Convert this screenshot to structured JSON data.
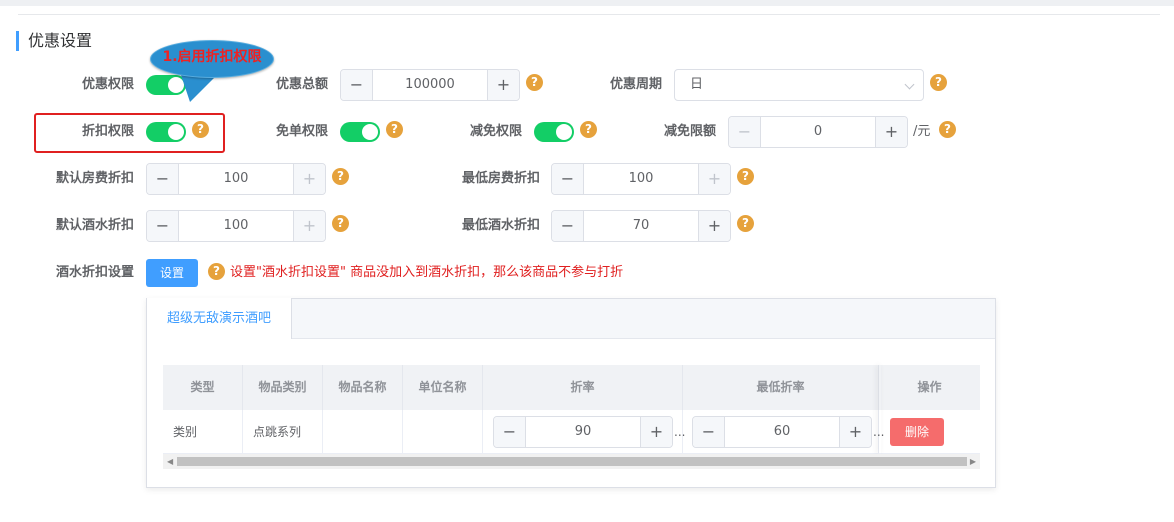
{
  "section": {
    "title": "优惠设置"
  },
  "callout": {
    "text": "1.启用折扣权限"
  },
  "form": {
    "row1": {
      "discount_auth_label": "优惠权限",
      "discount_total_label": "优惠总额",
      "discount_total_value": "100000",
      "discount_period_label": "优惠周期",
      "discount_period_value": "日"
    },
    "row2": {
      "rebate_auth_label": "折扣权限",
      "free_order_auth_label": "免单权限",
      "reduction_auth_label": "减免权限",
      "reduction_limit_label": "减免限额",
      "reduction_limit_value": "0",
      "reduction_limit_unit": "/元"
    },
    "row3": {
      "default_room_discount_label": "默认房费折扣",
      "default_room_discount_value": "100",
      "min_room_discount_label": "最低房费折扣",
      "min_room_discount_value": "100"
    },
    "row4": {
      "default_drink_discount_label": "默认酒水折扣",
      "default_drink_discount_value": "100",
      "min_drink_discount_label": "最低酒水折扣",
      "min_drink_discount_value": "70"
    },
    "row5": {
      "drink_discount_setting_label": "酒水折扣设置",
      "setting_button": "设置",
      "note": "设置\"酒水折扣设置\" 商品没加入到酒水折扣，那么该商品不参与打折"
    },
    "toggles": {
      "discount_auth": true,
      "rebate_auth": true,
      "free_order_auth": true,
      "reduction_auth": true
    }
  },
  "icons": {
    "help": "?",
    "minus": "−",
    "plus": "+",
    "scroll_left": "◀",
    "scroll_right": "▶"
  },
  "panel": {
    "tab": "超级无敌演示酒吧",
    "columns": [
      "类型",
      "物品类别",
      "物品名称",
      "单位名称",
      "折率",
      "最低折率",
      "操作"
    ],
    "rows": [
      {
        "type": "类别",
        "category": "点跳系列",
        "name": "",
        "unit": "",
        "rate": "90",
        "min_rate": "60",
        "action": "删除",
        "more": "..."
      }
    ]
  },
  "colors": {
    "accent": "#409eff",
    "switch_on": "#13ce66",
    "help": "#e6a23c",
    "danger": "#f56c6c",
    "highlight": "#e02020"
  }
}
